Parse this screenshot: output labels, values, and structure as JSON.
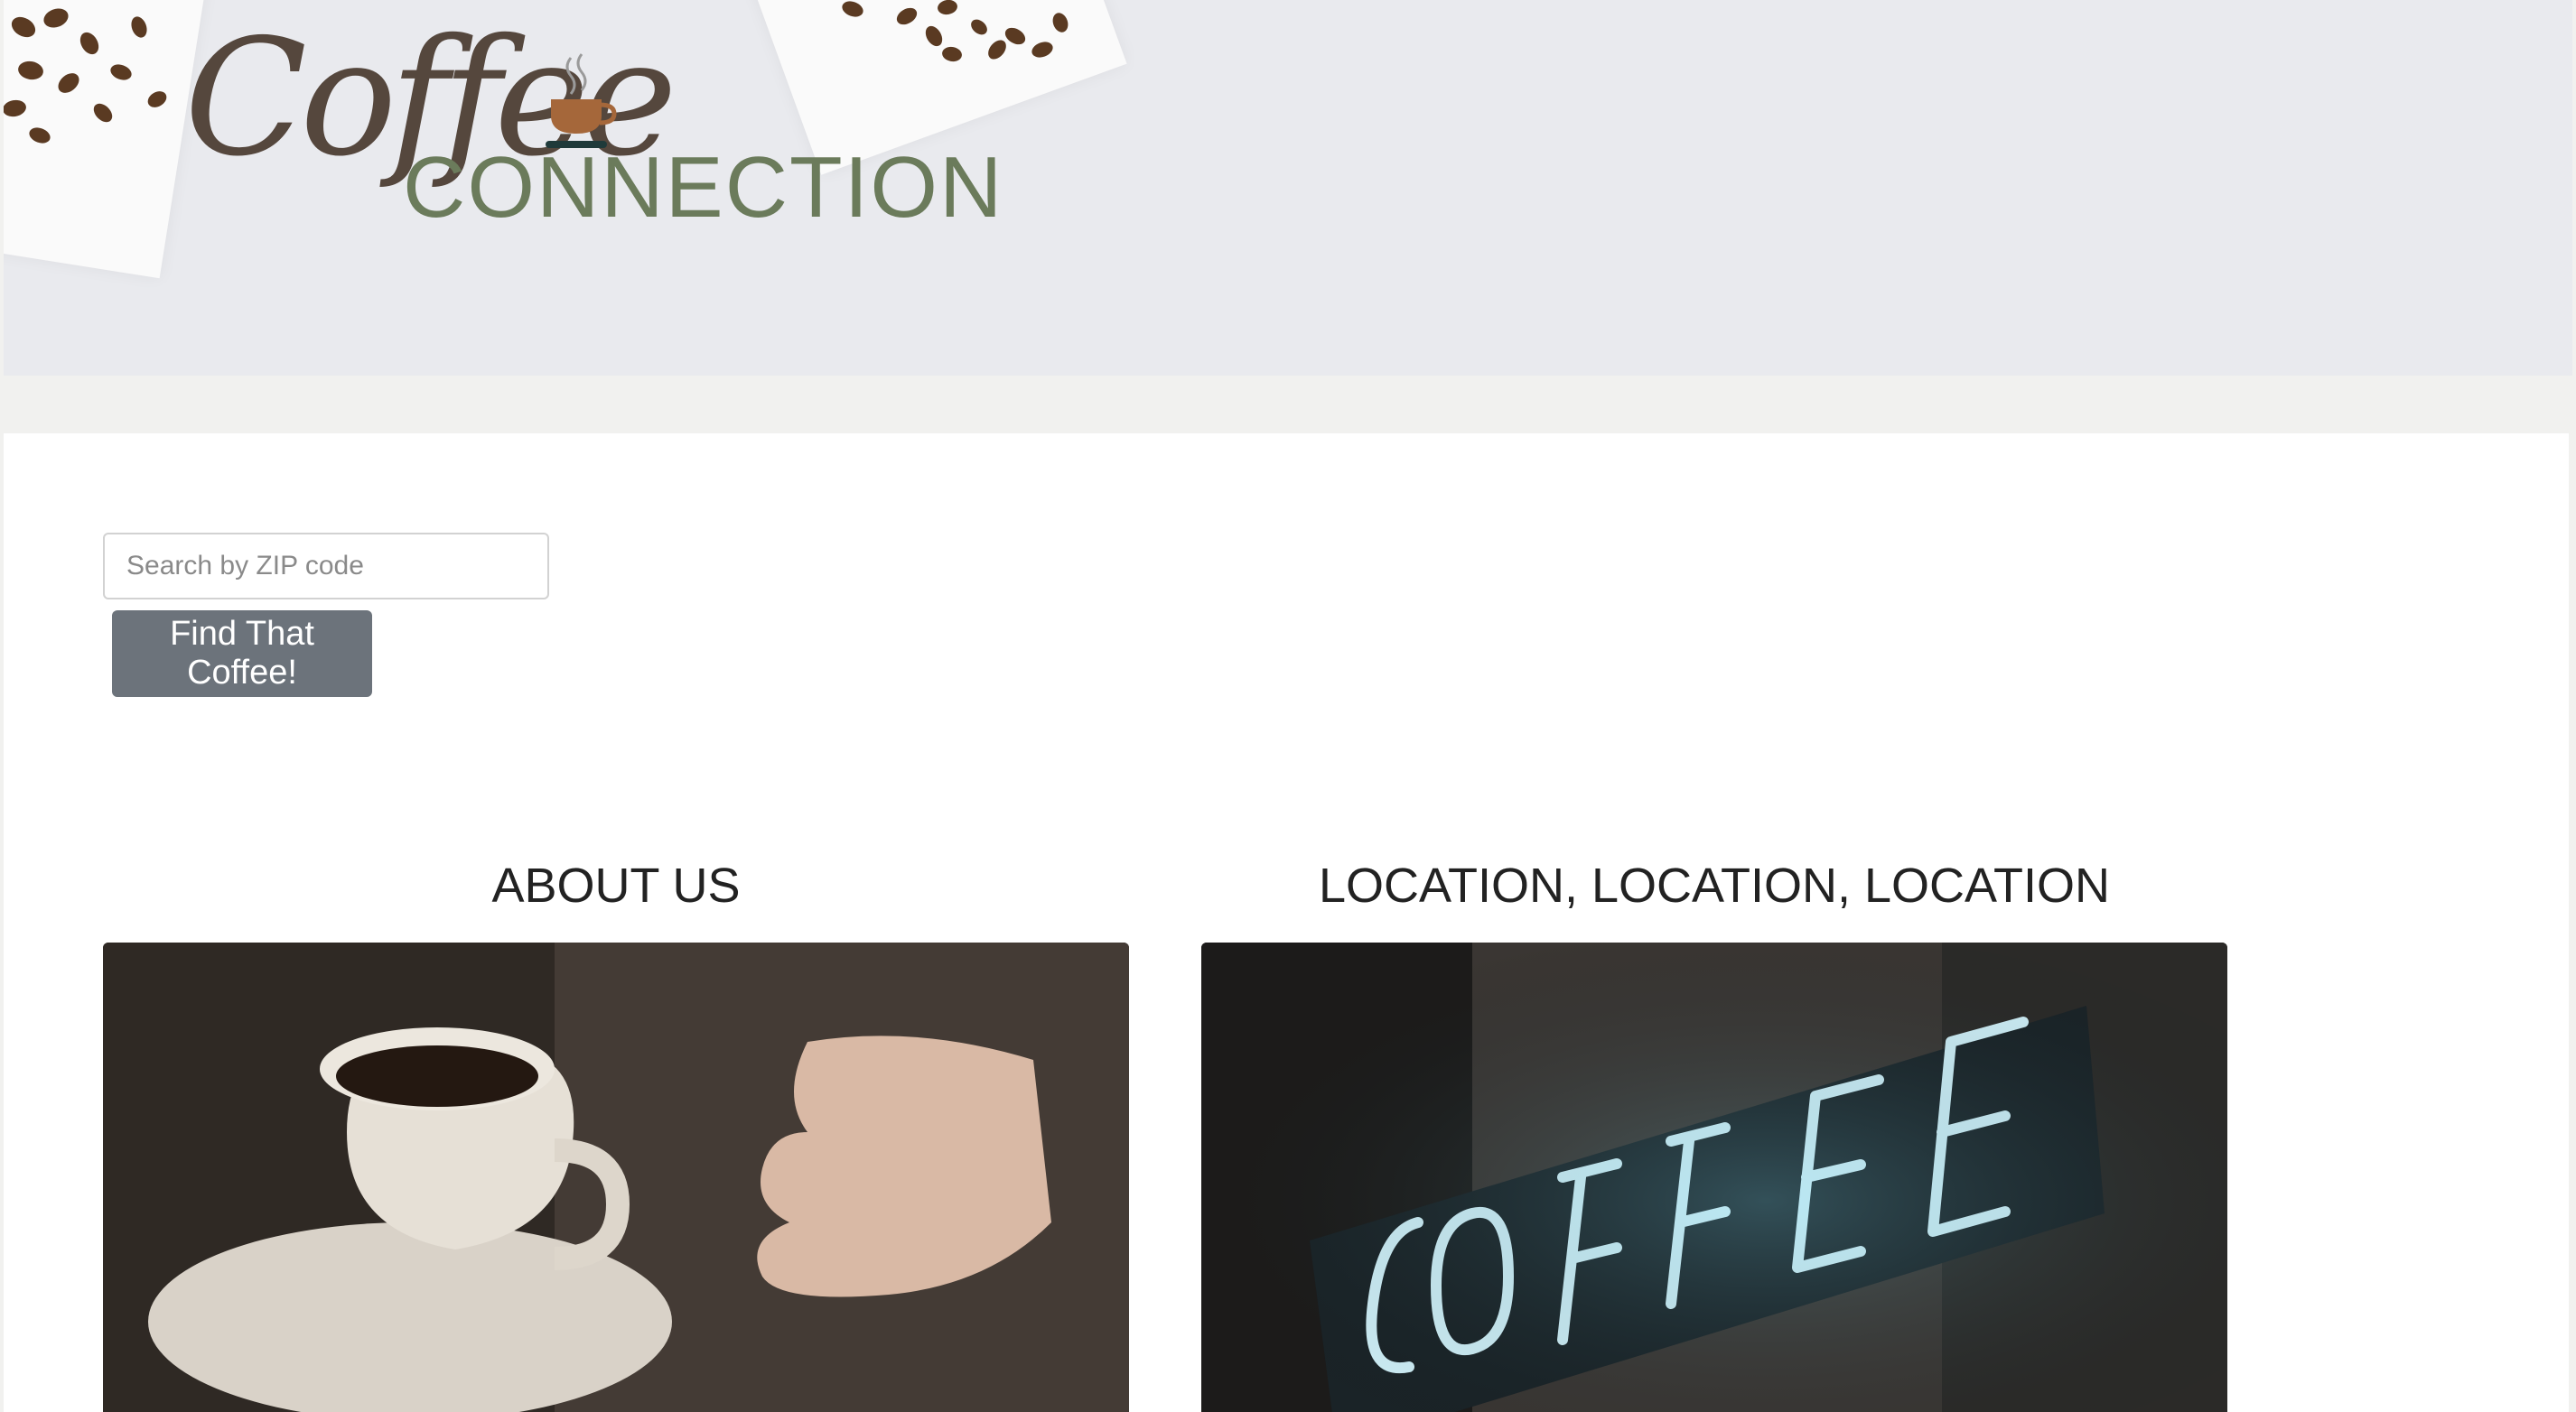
{
  "header": {
    "logo_script": "Coffee",
    "logo_sub": "CONNECTION"
  },
  "search": {
    "placeholder": "Search by ZIP code",
    "value": "",
    "button_label": "Find That Coffee!"
  },
  "sections": [
    {
      "title": "ABOUT US",
      "image": "coffee-cup-photo"
    },
    {
      "title": "LOCATION, LOCATION, LOCATION",
      "image": "neon-coffee-sign-photo"
    }
  ],
  "colors": {
    "header_bg": "#e9eaee",
    "logo_brown": "#55473d",
    "logo_green": "#6b7b5b",
    "button_bg": "#6c737b"
  }
}
